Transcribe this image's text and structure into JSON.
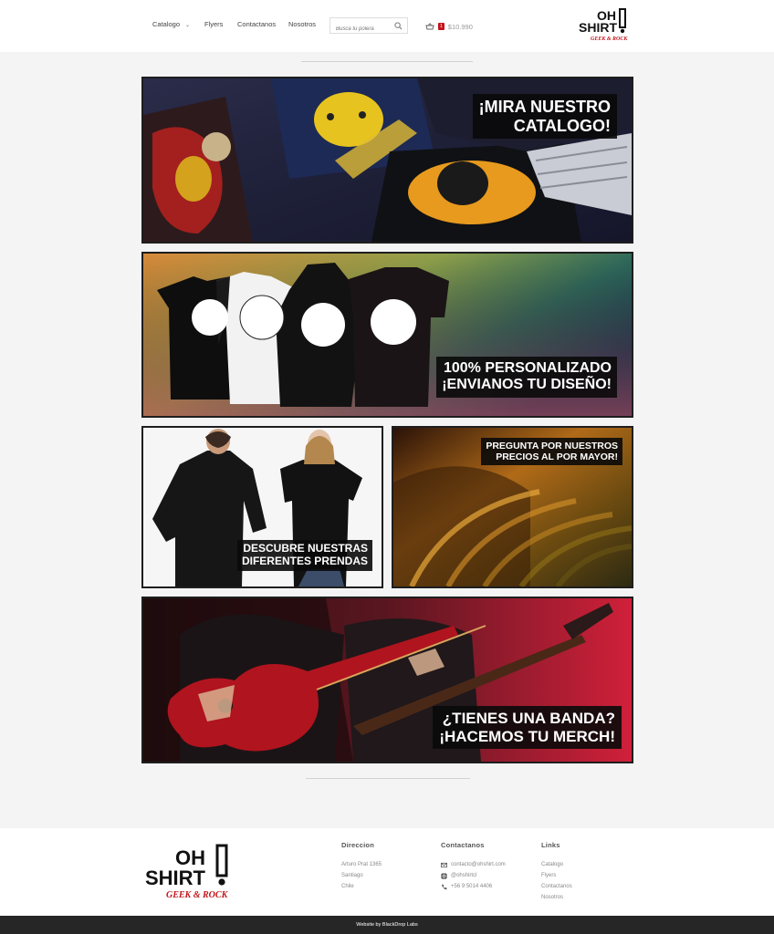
{
  "nav": {
    "catalogo": "Catalogo",
    "flyers": "Flyers",
    "contactanos": "Contactanos",
    "nosotros": "Nosotros"
  },
  "search": {
    "placeholder": "Busca tu polera"
  },
  "cart": {
    "count": "1",
    "total": "$10.990"
  },
  "logo": {
    "line1": "OH",
    "line2": "SHIRT",
    "tagline": "GEEK & ROCK"
  },
  "banners": {
    "catalog": {
      "line1": "¡MIRA NUESTRO",
      "line2": "CATALOGO!"
    },
    "custom": {
      "line1": "100% PERSONALIZADO",
      "line2": "¡ENVIANOS TU DISEÑO!"
    },
    "garments": {
      "line1": "DESCUBRE NUESTRAS",
      "line2": "DIFERENTES PRENDAS"
    },
    "wholesale": {
      "line1": "PREGUNTA POR NUESTROS",
      "line2": "PRECIOS AL POR MAYOR!"
    },
    "band": {
      "line1": "¿TIENES UNA BANDA?",
      "line2": "¡HACEMOS TU MERCH!"
    }
  },
  "footer": {
    "address": {
      "title": "Direccion",
      "street": "Arturo Prat 1365",
      "city": "Santiago",
      "country": "Chile"
    },
    "contact": {
      "title": "Contactanos",
      "email": "contacto@ohshirt.com",
      "instagram": "@ohshirtcl",
      "phone": "+56 9 5014 4406"
    },
    "links": {
      "title": "Links",
      "items": [
        "Catalogo",
        "Flyers",
        "Contactanos",
        "Nosotros"
      ]
    }
  },
  "credit": "Website by BlackDrop Labs",
  "colors": {
    "accent": "#c0141a",
    "dark": "#1e1e1e",
    "footer_bar": "#262626"
  }
}
